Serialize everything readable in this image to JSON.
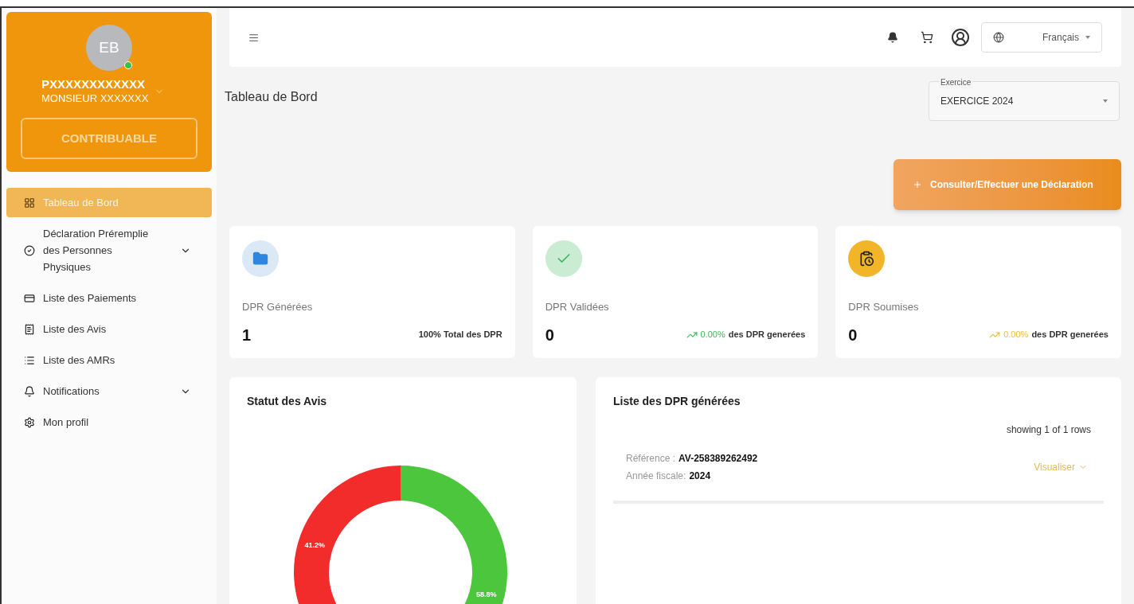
{
  "profile": {
    "initials": "EB",
    "online": true,
    "name": "PXXXXXXXXXXXX",
    "subtitle": "MONSIEUR XXXXXXX",
    "role": "CONTRIBUABLE"
  },
  "sidebar": {
    "items": [
      {
        "label": "Tableau de Bord",
        "selected": true,
        "expandable": false
      },
      {
        "label": "Déclaration Préremplie des Personnes Physiques",
        "selected": false,
        "expandable": true
      },
      {
        "label": "Liste des Paiements",
        "selected": false,
        "expandable": false
      },
      {
        "label": "Liste des Avis",
        "selected": false,
        "expandable": false
      },
      {
        "label": "Liste des AMRs",
        "selected": false,
        "expandable": false
      },
      {
        "label": "Notifications",
        "selected": false,
        "expandable": true
      },
      {
        "label": "Mon profil",
        "selected": false,
        "expandable": false
      }
    ]
  },
  "topbar": {
    "language": "Français"
  },
  "page_title": "Tableau de Bord",
  "exercise": {
    "label": "Exercice",
    "value": "EXERCICE 2024"
  },
  "action_button": "Consulter/Effectuer une Déclaration",
  "stats": [
    {
      "label": "DPR Générées",
      "value": "1",
      "trend": false,
      "note": "100% Total des DPR"
    },
    {
      "label": "DPR Validées",
      "value": "0",
      "trend": true,
      "percent": "0.00%",
      "note": "des DPR generées",
      "color": "#3cb95a"
    },
    {
      "label": "DPR Soumises",
      "value": "0",
      "trend": true,
      "percent": "0.00%",
      "note": "des DPR generées",
      "color": "#e8c040"
    }
  ],
  "status_chart": {
    "title": "Statut des Avis",
    "chart_data": {
      "type": "donut",
      "values": [
        58.8,
        41.2
      ],
      "colors": [
        "#4cc63c",
        "#f22b2b"
      ],
      "value_labels": [
        "58.8%",
        "41.2%"
      ]
    }
  },
  "dpr_list": {
    "title": "Liste des DPR générées",
    "count": "showing 1 of 1 rows",
    "rows": [
      {
        "reference_label": "Référence :",
        "reference": "AV-258389262492",
        "year_label": "Année fiscale:",
        "year": "2024",
        "action": "Visualiser"
      }
    ]
  }
}
